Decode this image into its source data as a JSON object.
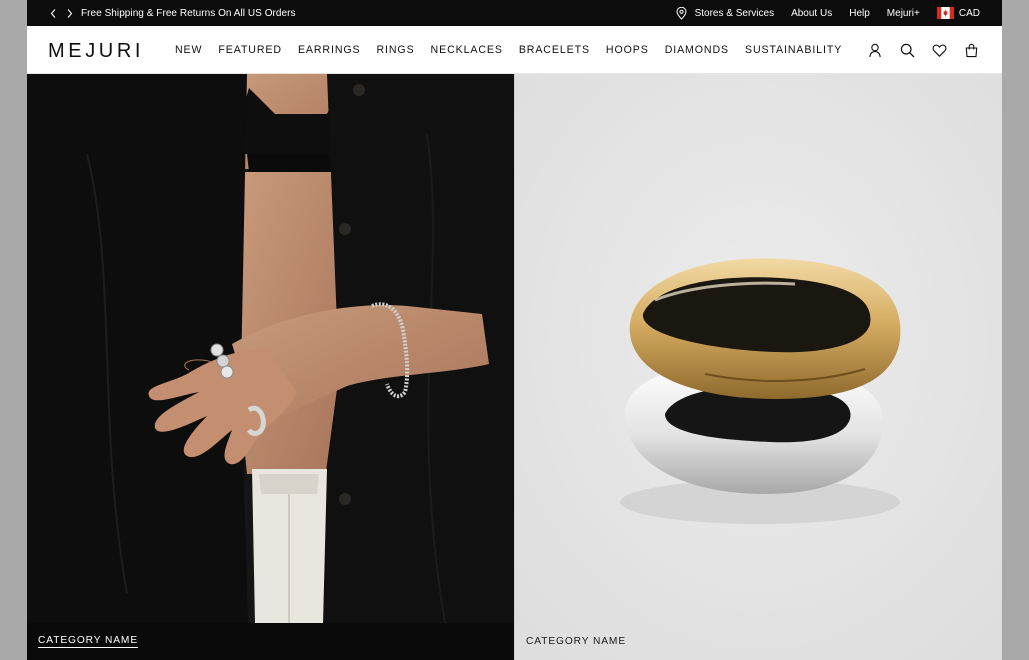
{
  "announcement": {
    "prev_icon": "chevron-left-icon",
    "next_icon": "chevron-right-icon",
    "text": "Free Shipping & Free Returns On All US Orders"
  },
  "utility_links": {
    "stores_icon": "map-pin-icon",
    "stores": "Stores & Services",
    "about": "About Us",
    "help": "Help",
    "plus": "Mejuri+",
    "flag_icon": "canada-flag-icon",
    "currency": "CAD"
  },
  "header": {
    "logo": "MEJURI",
    "nav": [
      "NEW",
      "FEATURED",
      "EARRINGS",
      "RINGS",
      "NECKLACES",
      "BRACELETS",
      "HOOPS",
      "DIAMONDS",
      "SUSTAINABILITY"
    ],
    "icons": [
      "account-icon",
      "search-icon",
      "heart-icon",
      "bag-icon"
    ]
  },
  "panels": {
    "left": {
      "caption": "CATEGORY NAME"
    },
    "right": {
      "caption": "CATEGORY NAME"
    }
  },
  "colors": {
    "topbar_bg": "#0c0c0c",
    "gold": "#d9b56a",
    "silver": "#d8d8d8"
  }
}
